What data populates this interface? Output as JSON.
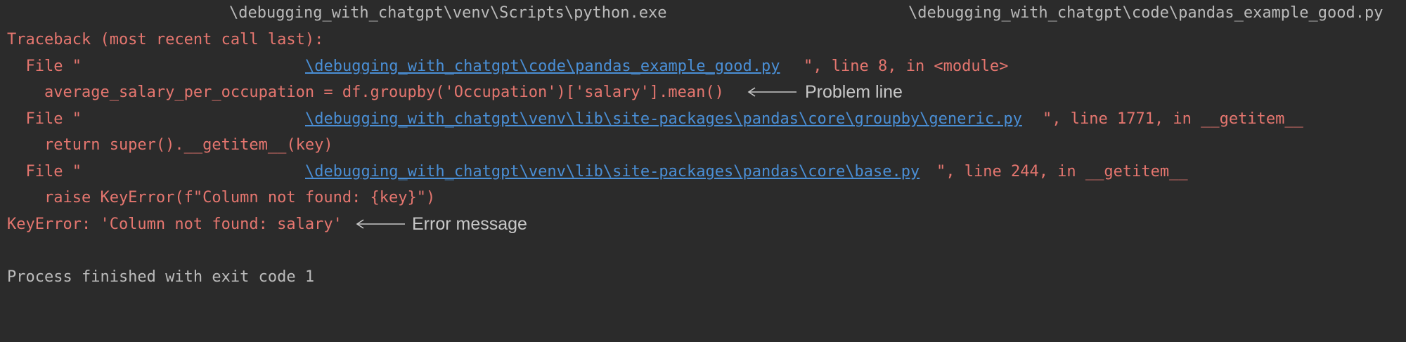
{
  "console": {
    "command": {
      "interpreter": "\\debugging_with_chatgpt\\venv\\Scripts\\python.exe",
      "script": "\\debugging_with_chatgpt\\code\\pandas_example_good.py"
    },
    "traceback_header": "Traceback (most recent call last):",
    "frames": [
      {
        "file_prefix": "  File \"",
        "path": "\\debugging_with_chatgpt\\code\\pandas_example_good.py",
        "suffix": "\", line 8, in <module>",
        "code": "    average_salary_per_occupation = df.groupby('Occupation')['salary'].mean()"
      },
      {
        "file_prefix": "  File \"",
        "path": "\\debugging_with_chatgpt\\venv\\lib\\site-packages\\pandas\\core\\groupby\\generic.py",
        "suffix": "\", line 1771, in __getitem__",
        "code": "    return super().__getitem__(key)"
      },
      {
        "file_prefix": "  File \"",
        "path": "\\debugging_with_chatgpt\\venv\\lib\\site-packages\\pandas\\core\\base.py",
        "suffix": "\", line 244, in __getitem__",
        "code": "    raise KeyError(f\"Column not found: {key}\")"
      }
    ],
    "error_line": "KeyError: 'Column not found: salary'",
    "exit_message": "Process finished with exit code 1"
  },
  "annotations": {
    "problem_line": "Problem line",
    "error_message": "Error message"
  },
  "colors": {
    "background": "#2b2b2b",
    "standard_text": "#bbbbbb",
    "error_text": "#e5766f",
    "link": "#4a8fd6",
    "annotation": "#c8c8c8"
  }
}
